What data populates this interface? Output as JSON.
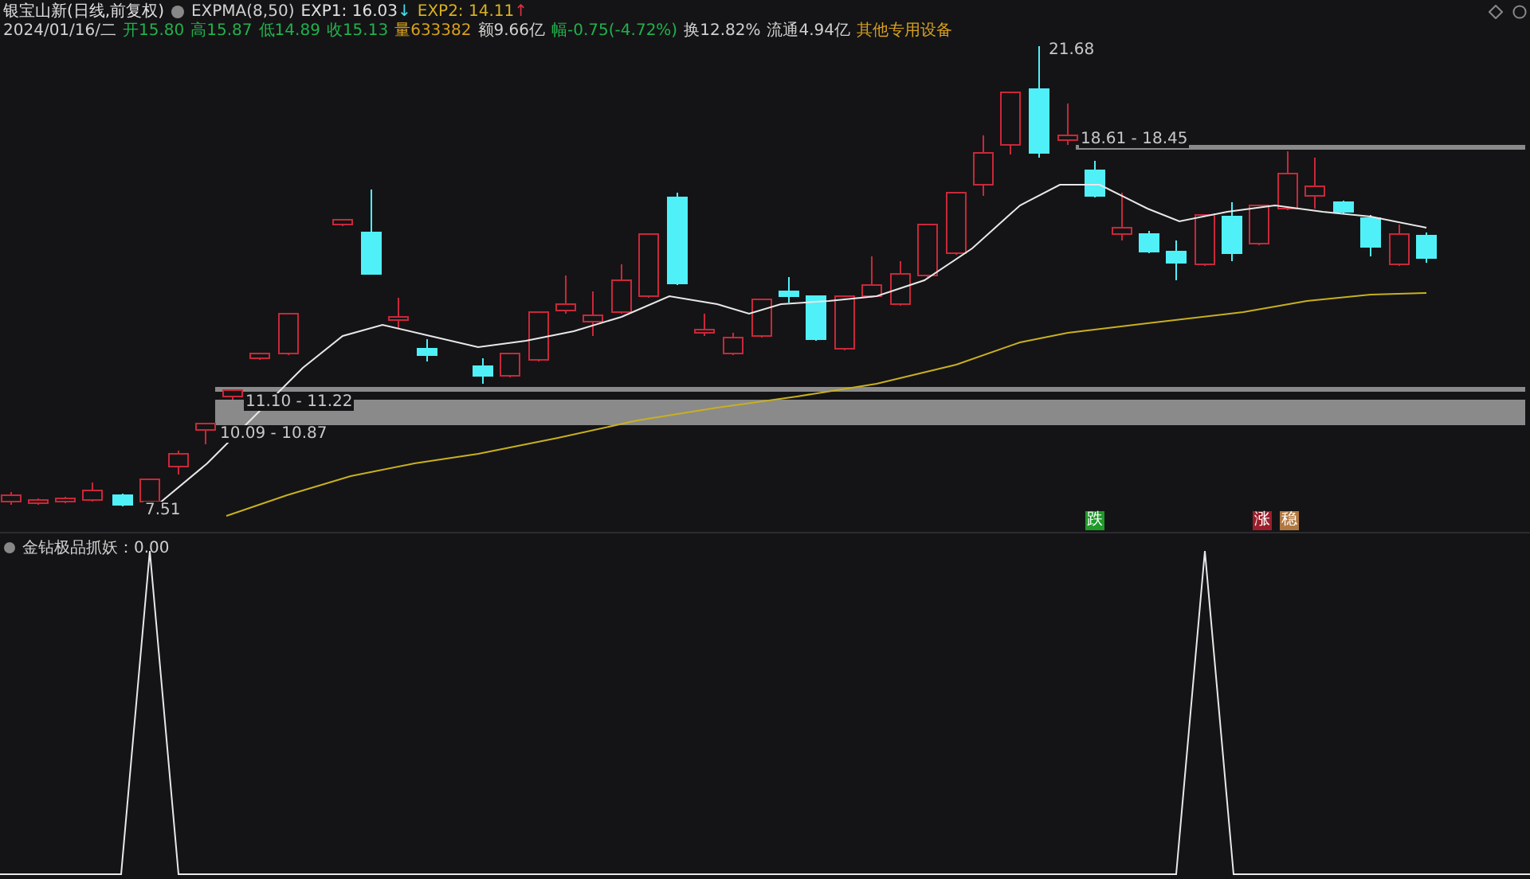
{
  "header": {
    "title": "银宝山新(日线,前复权)",
    "indicator": "EXPMA(8,50)",
    "lines": [
      {
        "label": "EXP1: 16.03",
        "color": "#e0e0e0",
        "arrow": {
          "text": "↓",
          "color": "#40e0f0"
        }
      },
      {
        "label": "EXP2: 14.11",
        "color": "#d8b020",
        "arrow": {
          "text": "↑",
          "color": "#e03040"
        }
      }
    ]
  },
  "info": {
    "date": "2024/01/16/二",
    "items": [
      {
        "text": "开15.80",
        "color": "#22b14c"
      },
      {
        "text": "高15.87",
        "color": "#22b14c"
      },
      {
        "text": "低14.89",
        "color": "#22b14c"
      },
      {
        "text": "收15.13",
        "color": "#22b14c"
      },
      {
        "text": "量633382",
        "color": "#d8a020"
      },
      {
        "text": "额9.66亿",
        "color": "#d0d0d0"
      },
      {
        "text": "幅-0.75(-4.72%)",
        "color": "#22b14c"
      },
      {
        "text": "换12.82%",
        "color": "#d0d0d0"
      },
      {
        "text": "流通4.94亿",
        "color": "#d0d0d0"
      },
      {
        "text": "其他专用设备",
        "color": "#d8a020"
      }
    ]
  },
  "price_labels": [
    "21.68",
    "18.61 - 18.45",
    "11.10 - 11.22",
    "10.09 - 10.87",
    "7.51"
  ],
  "signals": [
    {
      "text": "跌",
      "color": "#1f9a2a"
    },
    {
      "text": "涨",
      "color": "#9a1f2a"
    },
    {
      "text": "稳",
      "color": "#b07840"
    }
  ],
  "lower_panel": {
    "title": "金钻极品抓妖：0.00"
  }
}
